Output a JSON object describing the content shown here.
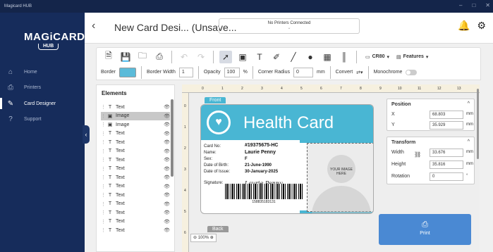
{
  "window": {
    "title": "Magicard HUB",
    "controls": [
      "–",
      "□",
      "✕"
    ]
  },
  "sidebar": {
    "brand": "MAGiCARD",
    "brand_sub": "HUB",
    "items": [
      {
        "label": "Home",
        "icon": "home-icon"
      },
      {
        "label": "Printers",
        "icon": "printer-icon"
      },
      {
        "label": "Card Designer",
        "icon": "edit-icon"
      },
      {
        "label": "Support",
        "icon": "help-icon"
      }
    ]
  },
  "header": {
    "title": "New Card Desi...  (Unsave...",
    "printer_status": "No Printers Connected",
    "icons": [
      "bell-icon",
      "gear-icon"
    ]
  },
  "toolbar": {
    "card_size": "CR80",
    "features_label": "Features"
  },
  "props_bar": {
    "border_label": "Border",
    "border_color": "#5bbbd9",
    "border_width_label": "Border Width",
    "border_width": "1",
    "opacity_label": "Opacity",
    "opacity": "100",
    "opacity_unit": "%",
    "corner_radius_label": "Corner Radius",
    "corner_radius": "0",
    "corner_unit": "mm",
    "convert_label": "Convert",
    "monochrome_label": "Monochrome"
  },
  "elements_panel": {
    "title": "Elements",
    "items": [
      {
        "type": "T",
        "name": "Text"
      },
      {
        "type": "▣",
        "name": "Image"
      },
      {
        "type": "▣",
        "name": "Image"
      },
      {
        "type": "T",
        "name": "Text"
      },
      {
        "type": "T",
        "name": "Text"
      },
      {
        "type": "T",
        "name": "Text"
      },
      {
        "type": "T",
        "name": "Text"
      },
      {
        "type": "T",
        "name": "Text"
      },
      {
        "type": "T",
        "name": "Text"
      },
      {
        "type": "T",
        "name": "Text"
      },
      {
        "type": "T",
        "name": "Text"
      },
      {
        "type": "T",
        "name": "Text"
      },
      {
        "type": "T",
        "name": "Text"
      },
      {
        "type": "T",
        "name": "Text"
      },
      {
        "type": "T",
        "name": "Text"
      }
    ]
  },
  "canvas": {
    "ruler_top": [
      "0",
      "1",
      "2",
      "3",
      "4",
      "5",
      "6",
      "7",
      "8",
      "9",
      "10",
      "11",
      "12",
      "13"
    ],
    "ruler_left": [
      "0",
      "1",
      "2",
      "3",
      "4",
      "5",
      "6"
    ],
    "front_tag": "Front",
    "back_tag": "Back",
    "zoom": "100%",
    "card": {
      "title": "Health Card",
      "fields": [
        {
          "label": "Card No:",
          "value": "#19375675-HC"
        },
        {
          "label": "Name:",
          "value": "Laurie Penny"
        },
        {
          "label": "Sex:",
          "value": "F"
        },
        {
          "label": "Date of Birth:",
          "value": "21-June-1990"
        },
        {
          "label": "Date of Issue:",
          "value": "30-January-2025"
        }
      ],
      "signature_label": "Signature:",
      "signature": "Laurie Penny",
      "photo_text": "YOUR IMAGE HERE",
      "barcode_number": "158835183131",
      "accent_color": "#49b6d3"
    }
  },
  "properties": {
    "position": {
      "title": "Position",
      "x_label": "X",
      "x": "68.803",
      "y_label": "Y",
      "y": "35.929",
      "unit": "mm"
    },
    "transform": {
      "title": "Transform",
      "width_label": "Width",
      "width": "33.676",
      "height_label": "Height",
      "height": "35.816",
      "rotation_label": "Rotation",
      "rotation": "0",
      "unit": "mm",
      "rot_unit": "°"
    }
  },
  "print_button": {
    "label": "Print"
  }
}
